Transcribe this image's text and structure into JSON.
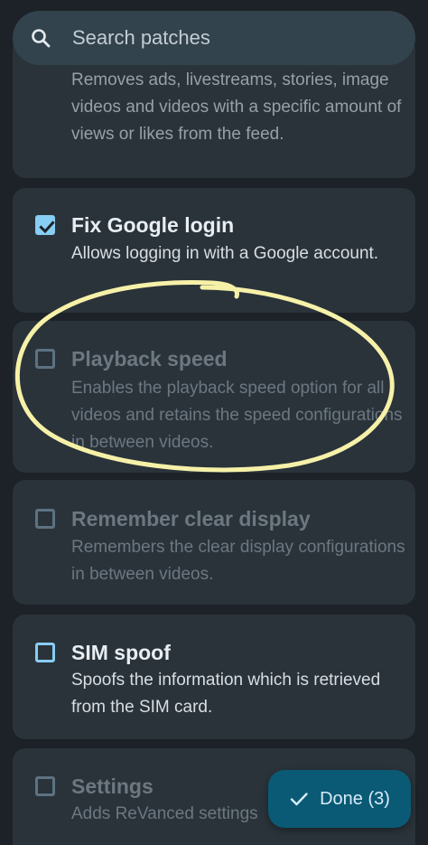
{
  "search": {
    "placeholder": "Search patches"
  },
  "patches": [
    {
      "title": "",
      "description": "Removes ads, livestreams, stories, image videos and videos with a specific amount of views or likes from the feed.",
      "checked": true,
      "enabled": true
    },
    {
      "title": "Fix Google login",
      "description": "Allows logging in with a Google account.",
      "checked": true,
      "enabled": true
    },
    {
      "title": "Playback speed",
      "description": "Enables the playback speed option for all videos and retains the speed configurations in between videos.",
      "checked": false,
      "enabled": false
    },
    {
      "title": "Remember clear display",
      "description": "Remembers the clear display configurations in between videos.",
      "checked": false,
      "enabled": false
    },
    {
      "title": "SIM spoof",
      "description": "Spoofs the information which is retrieved from the SIM card.",
      "checked": false,
      "enabled": true
    },
    {
      "title": "Settings",
      "description": "Adds ReVanced settings",
      "checked": false,
      "enabled": false
    }
  ],
  "done_button": {
    "label": "Done (3)"
  },
  "colors": {
    "background": "#1c2227",
    "card": "#2a333a",
    "search_bar": "#33434d",
    "checkbox_accent": "#88cdf3",
    "done_button": "#0a5a76",
    "highlight_stroke": "#f6f1a8"
  },
  "icons": {
    "search": "search-icon",
    "done": "check-icon"
  }
}
